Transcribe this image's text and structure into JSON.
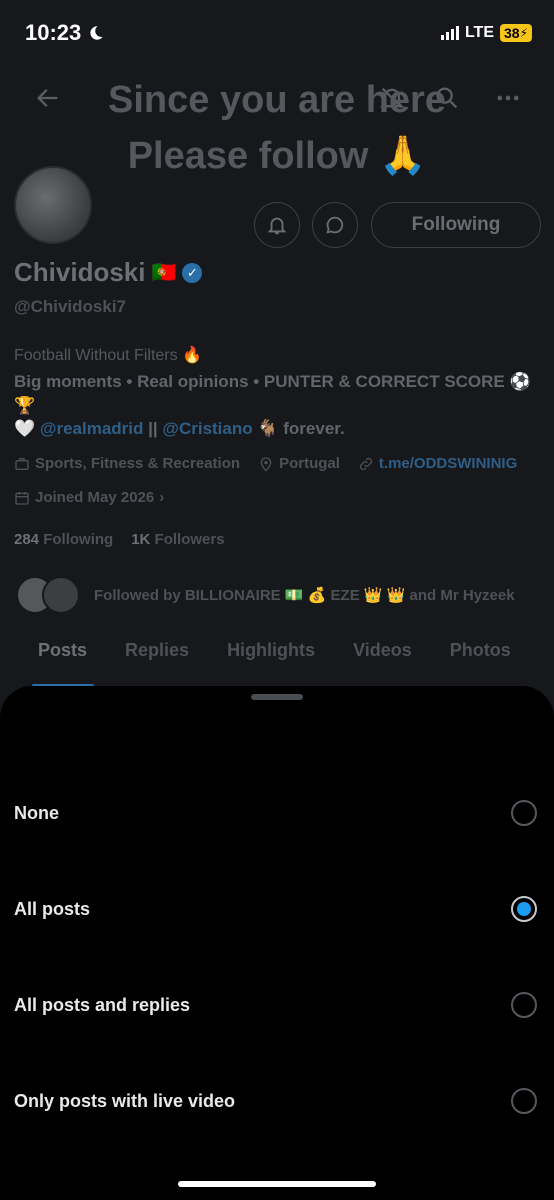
{
  "status_bar": {
    "time": "10:23",
    "network": "LTE",
    "battery": "38"
  },
  "overlay": {
    "line1": "Since you are here",
    "line2": "Please follow 🙏"
  },
  "profile": {
    "name": "Chividoski",
    "flag": "🇵🇹",
    "handle": "@Chividoski7",
    "bio_line1": "Football Without Filters 🔥",
    "bio_line2": "Big moments • Real opinions • PUNTER & CORRECT SCORE ⚽🏆",
    "bio_line3_prefix": "🤍 ",
    "bio_link1": "@realmadrid",
    "bio_sep": " || ",
    "bio_link2": "@Cristiano",
    "bio_line3_suffix": " 🐐 forever.",
    "category": "Sports, Fitness & Recreation",
    "location": "Portugal",
    "website": "t.me/ODDSWININIG",
    "joined": "Joined May 2026",
    "following_count": "284",
    "following_label": "Following",
    "followers_count": "1K",
    "followers_label": "Followers",
    "followed_by": "Followed by BILLIONAIRE 💵 💰 EZE 👑 👑 and Mr Hyzeek",
    "following_button": "Following"
  },
  "tabs": [
    "Posts",
    "Replies",
    "Highlights",
    "Videos",
    "Photos"
  ],
  "sheet": {
    "options": [
      {
        "label": "None",
        "checked": false
      },
      {
        "label": "All posts",
        "checked": true
      },
      {
        "label": "All posts and replies",
        "checked": false
      },
      {
        "label": "Only posts with live video",
        "checked": false
      }
    ]
  }
}
